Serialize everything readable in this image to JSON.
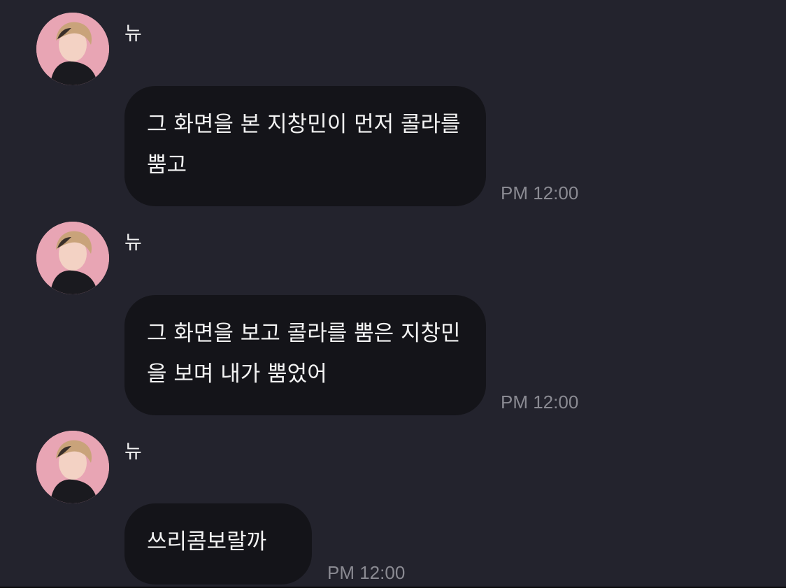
{
  "messages": [
    {
      "sender": "뉴",
      "text": "그 화면을 본 지창민이 먼저 콜라를 뿜고",
      "time": "PM 12:00"
    },
    {
      "sender": "뉴",
      "text": "그 화면을 보고 콜라를 뿜은 지창민을 보며 내가 뿜었어",
      "time": "PM 12:00"
    },
    {
      "sender": "뉴",
      "text": "쓰리콤보랄까",
      "time": "PM 12:00"
    }
  ],
  "colors": {
    "background": "#23232d",
    "bubble": "#141419",
    "text": "#f3f3f3",
    "timestamp": "#8a8a92",
    "avatar_bg": "#e8a5b4"
  }
}
